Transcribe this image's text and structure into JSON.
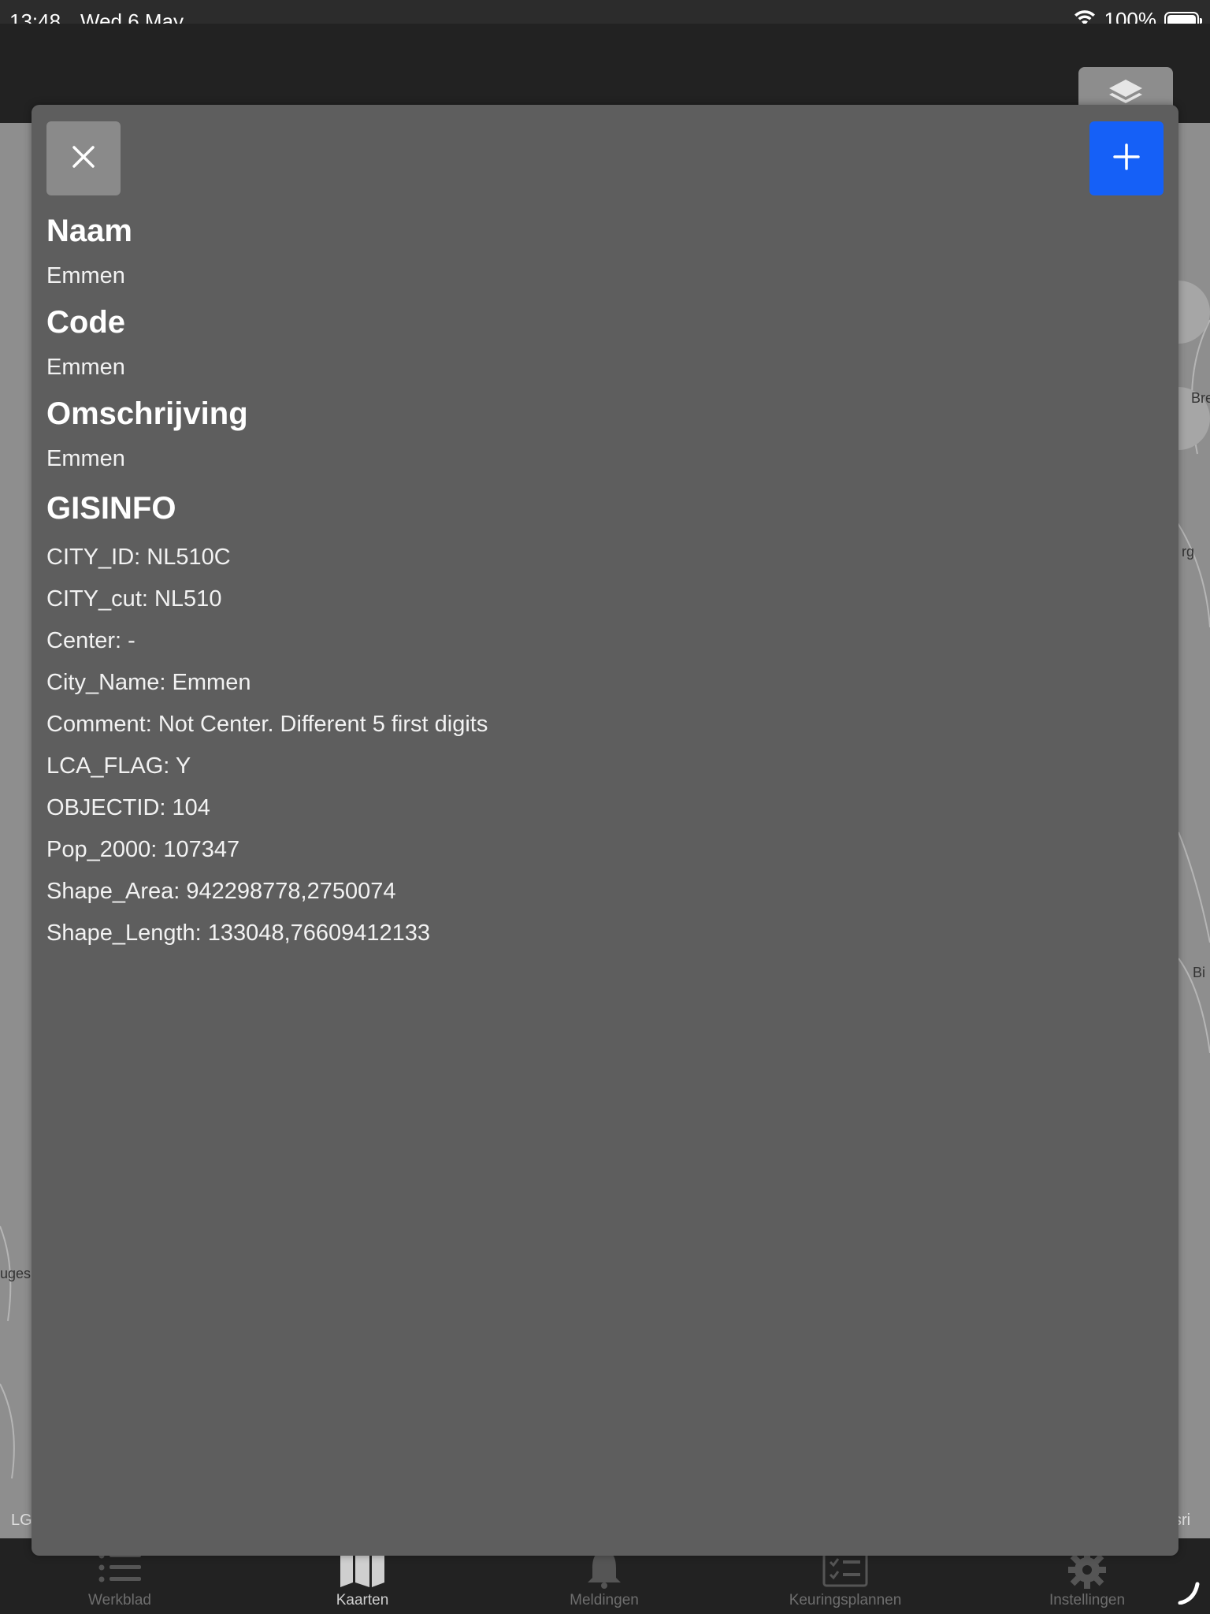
{
  "status_bar": {
    "time": "13:48",
    "date": "Wed 6 May",
    "battery": "100%"
  },
  "map": {
    "labels": [
      "Bre",
      "rg",
      "Bi",
      "uges"
    ],
    "bottom_left": "LG",
    "bottom_right": "sri"
  },
  "panel": {
    "close_icon": "close-icon",
    "add_icon": "plus-icon",
    "fields": [
      {
        "title": "Naam",
        "value": "Emmen"
      },
      {
        "title": "Code",
        "value": "Emmen"
      },
      {
        "title": "Omschrijving",
        "value": "Emmen"
      }
    ],
    "gis_title": "GISINFO",
    "gis_rows": [
      "CITY_ID: NL510C",
      "CITY_cut: NL510",
      "Center: -",
      "City_Name: Emmen",
      "Comment: Not Center. Different 5 first digits",
      "LCA_FLAG: Y",
      "OBJECTID: 104",
      "Pop_2000: 107347",
      "Shape_Area: 942298778,2750074",
      "Shape_Length: 133048,76609412133"
    ]
  },
  "tabs": [
    {
      "label": "Werkblad",
      "icon": "list-icon",
      "active": false
    },
    {
      "label": "Kaarten",
      "icon": "map-icon",
      "active": true
    },
    {
      "label": "Meldingen",
      "icon": "bell-icon",
      "active": false
    },
    {
      "label": "Keuringsplannen",
      "icon": "checklist-icon",
      "active": false
    },
    {
      "label": "Instellingen",
      "icon": "gear-icon",
      "active": false
    }
  ],
  "colors": {
    "panel": "#5e5e5e",
    "add_button": "#1560f7",
    "close_button": "#8a8a8a",
    "bar": "#222222"
  }
}
